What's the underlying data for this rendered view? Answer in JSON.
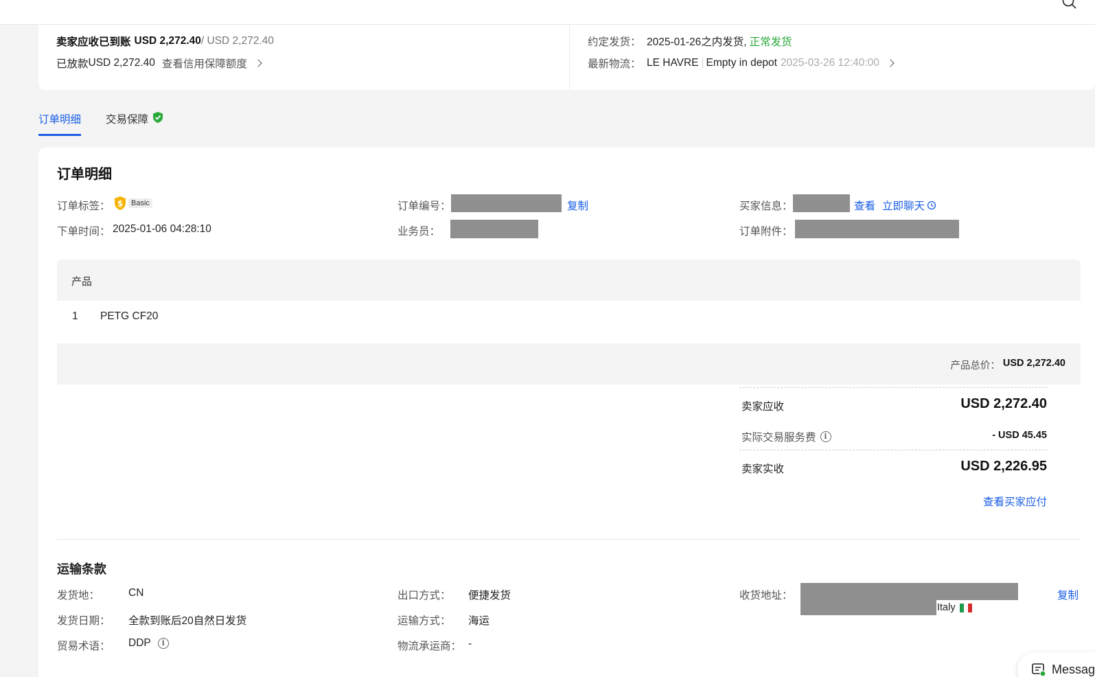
{
  "summary": {
    "seller_receivable_label": "卖家应收已到账",
    "seller_receivable_value": "USD 2,272.40",
    "seller_receivable_total": "/ USD 2,272.40",
    "released_label": "已放款",
    "released_value": "USD 2,272.40",
    "credit_link": "查看信用保障额度",
    "ship_label": "约定发货：",
    "ship_value": "2025-01-26之内发货,",
    "ship_status": "正常发货",
    "logistics_label": "最新物流：",
    "logistics_place": "LE HAVRE",
    "logistics_status": "Empty in depot",
    "logistics_time": "2025-03-26 12:40:00"
  },
  "tabs": [
    {
      "label": "订单明细",
      "active": true
    },
    {
      "label": "交易保障",
      "active": false
    }
  ],
  "order_detail": {
    "title": "订单明细",
    "tag_label": "订单标签：",
    "tag_badge": "Basic",
    "order_no_label": "订单编号：",
    "copy_label": "复制",
    "buyer_label": "买家信息：",
    "view_label": "查看",
    "chat_label": "立即聊天",
    "order_time_label": "下单时间：",
    "order_time_value": "2025-01-06 04:28:10",
    "salesperson_label": "业务员：",
    "attachment_label": "订单附件："
  },
  "product_table": {
    "header": "产品",
    "rows": [
      {
        "index": "1",
        "name": "PETG CF20"
      }
    ],
    "total_label": "产品总价：",
    "total_value": "USD 2,272.40"
  },
  "settlement": {
    "receivable_label": "卖家应收",
    "receivable_value": "USD 2,272.40",
    "fee_label": "实际交易服务费",
    "fee_value": "- USD 45.45",
    "actual_label": "卖家实收",
    "actual_value": "USD 2,226.95",
    "buyer_pay_link": "查看买家应付"
  },
  "shipping": {
    "title": "运输条款",
    "origin_label": "发货地：",
    "origin_value": "CN",
    "date_label": "发货日期：",
    "date_value": "全款到账后20自然日发货",
    "incoterm_label": "贸易术语：",
    "incoterm_value": "DDP",
    "export_label": "出口方式：",
    "export_value": "便捷发货",
    "transport_label": "运输方式：",
    "transport_value": "海运",
    "carrier_label": "物流承运商：",
    "carrier_value": "-",
    "address_label": "收货地址：",
    "address_country": "Italy",
    "copy_label": "复制"
  },
  "message_button": {
    "label": "Messag"
  },
  "colors": {
    "accent": "#1a5ee6",
    "success": "#2aa83a",
    "badge": "#f5b400"
  }
}
